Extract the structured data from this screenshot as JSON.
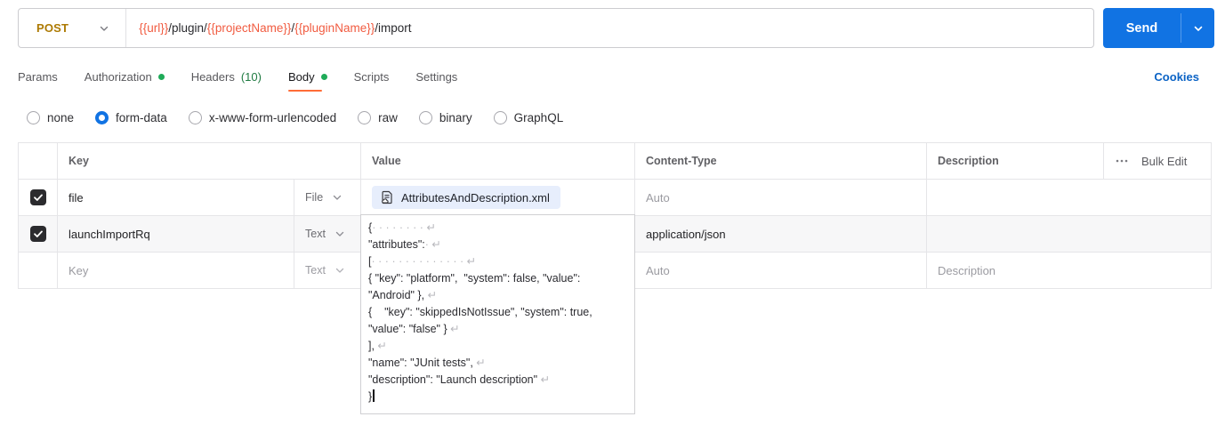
{
  "request": {
    "method": "POST",
    "url_segments": [
      {
        "text": "{{url}}",
        "variable": true
      },
      {
        "text": "/plugin/",
        "variable": false
      },
      {
        "text": "{{projectName}}",
        "variable": true
      },
      {
        "text": "/",
        "variable": false
      },
      {
        "text": "{{pluginName}}",
        "variable": true
      },
      {
        "text": "/import",
        "variable": false
      }
    ],
    "send_label": "Send"
  },
  "tabs": {
    "items": [
      {
        "label": "Params"
      },
      {
        "label": "Authorization",
        "has_dot": true
      },
      {
        "label": "Headers",
        "count": "(10)"
      },
      {
        "label": "Body",
        "has_dot": true,
        "active": true
      },
      {
        "label": "Scripts"
      },
      {
        "label": "Settings"
      }
    ],
    "cookies_link": "Cookies"
  },
  "body_modes": {
    "options": [
      "none",
      "form-data",
      "x-www-form-urlencoded",
      "raw",
      "binary",
      "GraphQL"
    ],
    "selected": "form-data"
  },
  "form_table": {
    "headers": {
      "key": "Key",
      "value": "Value",
      "content_type": "Content-Type",
      "description": "Description",
      "bulk_edit": "Bulk Edit"
    },
    "rows": [
      {
        "checked": true,
        "key": "file",
        "type": "File",
        "file_name": "AttributesAndDescription.xml",
        "content_type": "Auto"
      },
      {
        "checked": true,
        "key": "launchImportRq",
        "type": "Text",
        "content_type": "application/json"
      },
      {
        "checked": false,
        "key_placeholder": "Key",
        "type": "Text",
        "content_type": "Auto",
        "description_placeholder": "Description"
      }
    ],
    "value_editor_text": "{· · · · · · · · ↵\n\"attributes\":· ↵\n[· · · · · · · · · · · · · · ↵\n{ \"key\": \"platform\",  \"system\": false, \"value\": \"Android\" }, ↵\n{    \"key\": \"skippedIsNotIssue\", \"system\": true, \"value\": \"false\" } ↵\n], ↵\n\"name\": \"JUnit tests\", ↵\n\"description\": \"Launch description\" ↵\n}"
  },
  "colors": {
    "method_post": "#ad7a03",
    "url_variable": "#f15b40",
    "send_button": "#1173e3",
    "cookies_link": "#0b63c5",
    "tab_active_underline": "#ff6c37",
    "status_dot_green": "#1fab58",
    "headers_count_green": "#1f7a41",
    "file_chip_bg": "#e7eefc",
    "row_tint": "#f7f7f8"
  }
}
